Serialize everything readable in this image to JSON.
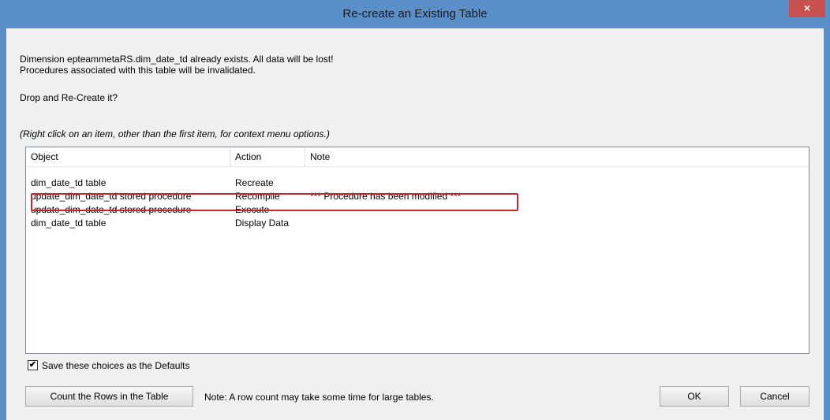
{
  "window": {
    "title": "Re-create an Existing Table",
    "close_glyph": "×"
  },
  "message": {
    "line1": "Dimension epteammetaRS.dim_date_td already exists. All data will be lost!",
    "line2": "Procedures associated with this table will be invalidated.",
    "question": "Drop and Re-Create it?",
    "hint": "(Right click on an item, other than the first item, for context menu options.)"
  },
  "table": {
    "columns": [
      "Object",
      "Action",
      "Note"
    ],
    "rows": [
      {
        "object": "dim_date_td table",
        "action": "Recreate",
        "note": ""
      },
      {
        "object": "update_dim_date_td stored procedure",
        "action": "Recompile",
        "note": "*** Procedure has been modified ***"
      },
      {
        "object": "update_dim_date_td stored procedure",
        "action": "Execute",
        "note": ""
      },
      {
        "object": "dim_date_td table",
        "action": "Display Data",
        "note": ""
      }
    ]
  },
  "defaults": {
    "checked": true,
    "label": "Save these choices as the Defaults",
    "check_glyph": "✔"
  },
  "footer": {
    "count_button": "Count the Rows in the Table",
    "note": "Note: A row count may take some time for large tables.",
    "ok_button": "OK",
    "cancel_button": "Cancel"
  },
  "colors": {
    "titlebar": "#5a8fc8",
    "close_button": "#c75050",
    "highlight_border": "#c0282d"
  }
}
